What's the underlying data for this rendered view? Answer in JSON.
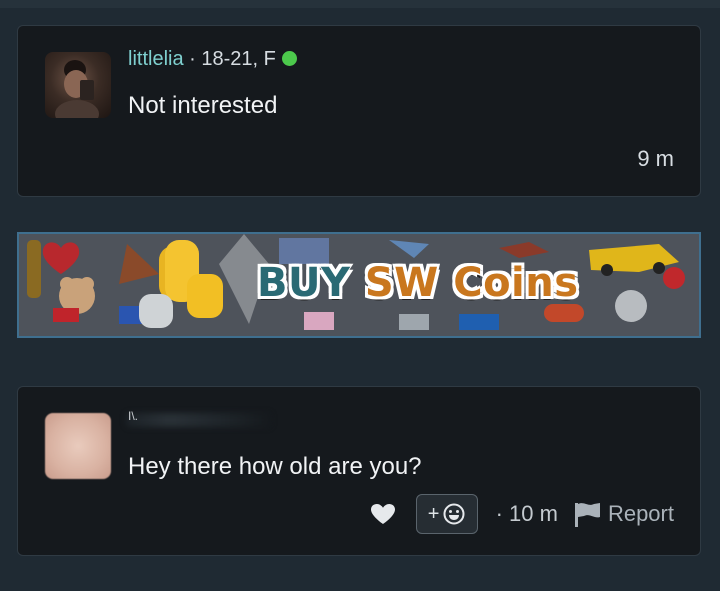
{
  "post1": {
    "username": "littlelia",
    "separator": " · ",
    "user_info": "18-21, F",
    "online_color": "#4cc94c",
    "message": "Not interested",
    "time": "9 m"
  },
  "ad_banner": {
    "title_word1": "BUY ",
    "title_word2": "SW Coins"
  },
  "post2": {
    "username_partial": "I\\.",
    "message": "Hey there how old are you?",
    "react_label": "+",
    "time": "· 10 m",
    "report_label": "Report"
  },
  "colors": {
    "background": "#1f2a33",
    "card": "#15191d",
    "username": "#7fd0cf",
    "banner_border": "#3f6f8f"
  }
}
